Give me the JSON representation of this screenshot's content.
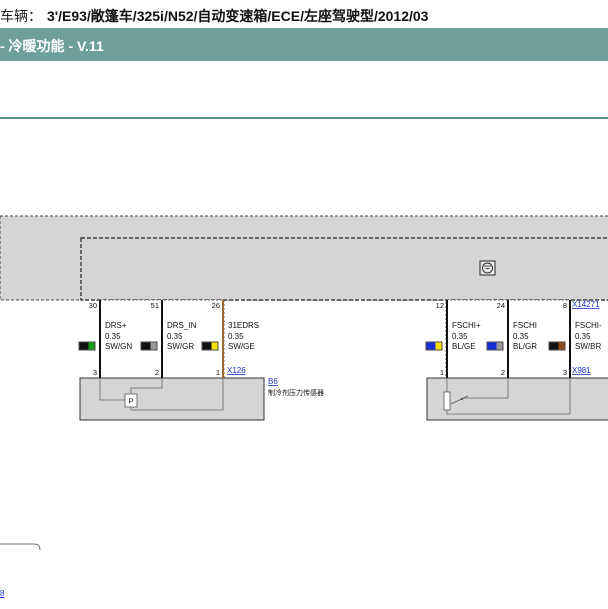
{
  "header": {
    "vehicle_label": "车辆：",
    "vehicle_value": "3'/E93/敞篷车/325i/N52/自动变速箱/ECE/左座驾驶型/2012/03",
    "title": "- 冷暖功能 - V.11"
  },
  "connectors": {
    "left_bottom": "X126",
    "right_top": "X14271",
    "right_bottom": "X981"
  },
  "component": {
    "id": "B6",
    "name": "制冷剂压力传感器",
    "symbol": "P"
  },
  "icons": {
    "module": "ground-symbol-icon"
  },
  "wires": [
    {
      "pin_top": "30",
      "pin_bottom": "3",
      "name": "DRS+",
      "size": "0.35",
      "color_code": "SW/GN",
      "swatch": [
        "#111111",
        "#12a012"
      ],
      "line": "#111111"
    },
    {
      "pin_top": "51",
      "pin_bottom": "2",
      "name": "DRS_IN",
      "size": "0.35",
      "color_code": "SW/GR",
      "swatch": [
        "#111111",
        "#9a9a9a"
      ],
      "line": "#111111"
    },
    {
      "pin_top": "26",
      "pin_bottom": "1",
      "name": "31EDRS",
      "size": "0.35",
      "color_code": "SW/GE",
      "swatch": [
        "#111111",
        "#f2e000"
      ],
      "line": "#9a6a2e"
    },
    {
      "pin_top": "12",
      "pin_bottom": "1",
      "name": "FSCHI+",
      "size": "0.35",
      "color_code": "BL/GE",
      "swatch": [
        "#1a2ed6",
        "#f2e000"
      ],
      "line": "#111111"
    },
    {
      "pin_top": "24",
      "pin_bottom": "2",
      "name": "FSCHI",
      "size": "0.35",
      "color_code": "BL/GR",
      "swatch": [
        "#1a2ed6",
        "#9a9a9a"
      ],
      "line": "#111111"
    },
    {
      "pin_top": "8",
      "pin_bottom": "3",
      "name": "FSCHI-",
      "size": "0.35",
      "color_code": "SW/BR",
      "swatch": [
        "#111111",
        "#8a4a1a"
      ],
      "line": "#111111"
    }
  ],
  "footer": {
    "link_text": "8"
  }
}
